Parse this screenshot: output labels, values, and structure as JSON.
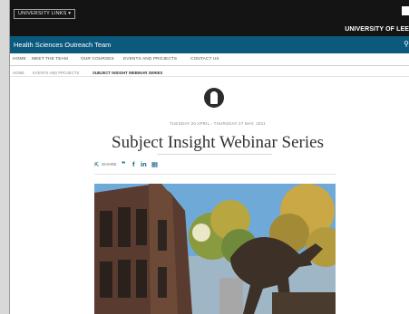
{
  "topbar": {
    "university_links_label": "UNIVERSITY LINKS ▾",
    "university_name": "UNIVERSITY OF LEE"
  },
  "siteband": {
    "site_title": "Health Sciences Outreach Team",
    "search_icon": "search-icon"
  },
  "nav": {
    "items": [
      "HOME",
      "MEET THE TEAM",
      "OUR COURSES",
      "EVENTS AND PROJECTS",
      "CONTACT US"
    ]
  },
  "breadcrumb": {
    "items": [
      "HOME",
      "EVENTS AND PROJECTS",
      "SUBJECT INSIGHT WEBINAR SERIES"
    ]
  },
  "event": {
    "logo_icon": "university-crest-icon",
    "date_range": "TUESDAY 20 APRIL - THURSDAY 27 MAY, 2021",
    "title": "Subject Insight Webinar Series"
  },
  "share": {
    "label": "SHARE",
    "icons": {
      "share": "⇱",
      "twitter": "❞",
      "facebook": "f",
      "linkedin": "in",
      "calendar": "▦"
    }
  },
  "hero": {
    "icon": "campus-photo",
    "colors": {
      "sky": "#6ea9d8",
      "building": "#5a3b2f",
      "foliage": "#cbb24a",
      "statue": "#3d3127"
    }
  }
}
